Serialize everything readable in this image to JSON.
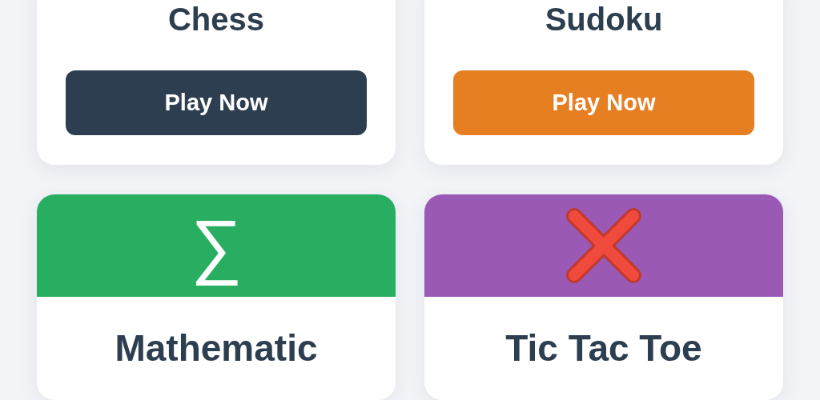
{
  "games": [
    {
      "title": "Chess",
      "button": {
        "label": "Play Now",
        "color": "#2c3e50"
      }
    },
    {
      "title": "Sudoku",
      "button": {
        "label": "Play Now",
        "color": "#e67e22"
      }
    },
    {
      "title": "Mathematic",
      "header": {
        "color": "#27ae60",
        "kind": "symbol",
        "symbol": "∑"
      }
    },
    {
      "title": "Tic Tac Toe",
      "header": {
        "color": "#9b59b6",
        "kind": "cross"
      }
    }
  ]
}
